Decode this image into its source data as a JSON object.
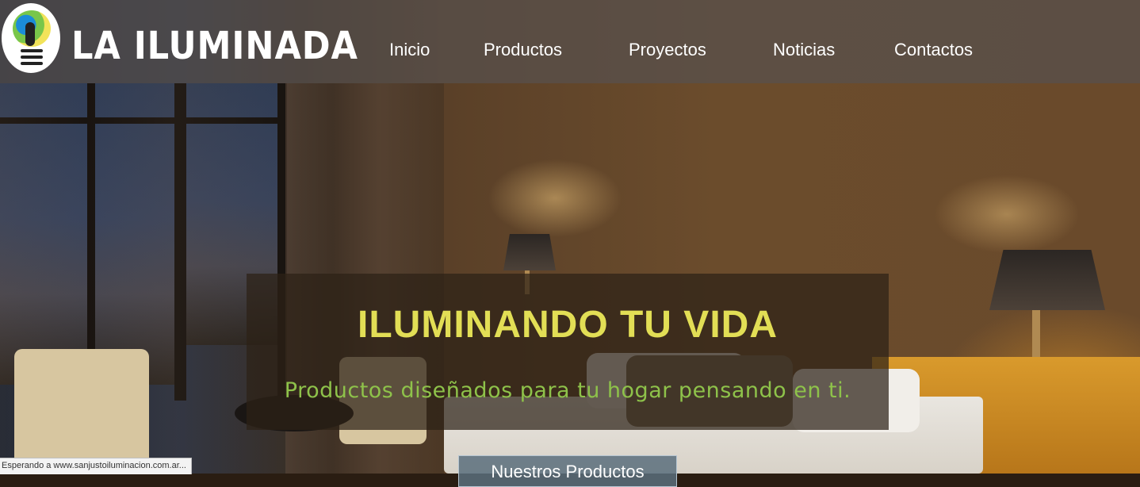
{
  "brand": {
    "name": "LA ILUMINADA",
    "logo_icon": "lightbulb-icon"
  },
  "nav": {
    "items": [
      {
        "label": "Inicio"
      },
      {
        "label": "Productos"
      },
      {
        "label": "Proyectos"
      },
      {
        "label": "Noticias"
      },
      {
        "label": "Contactos"
      }
    ]
  },
  "hero": {
    "title": "ILUMINANDO TU VIDA",
    "subtitle": "Productos diseñados para tu hogar pensando en ti.",
    "cta_label": "Nuestros Productos"
  },
  "browser_status": {
    "text": "Esperando a www.sanjustoiluminacion.com.ar..."
  },
  "colors": {
    "title": "#e2de55",
    "subtitle": "#8ec24a",
    "nav_text": "#ffffff"
  }
}
